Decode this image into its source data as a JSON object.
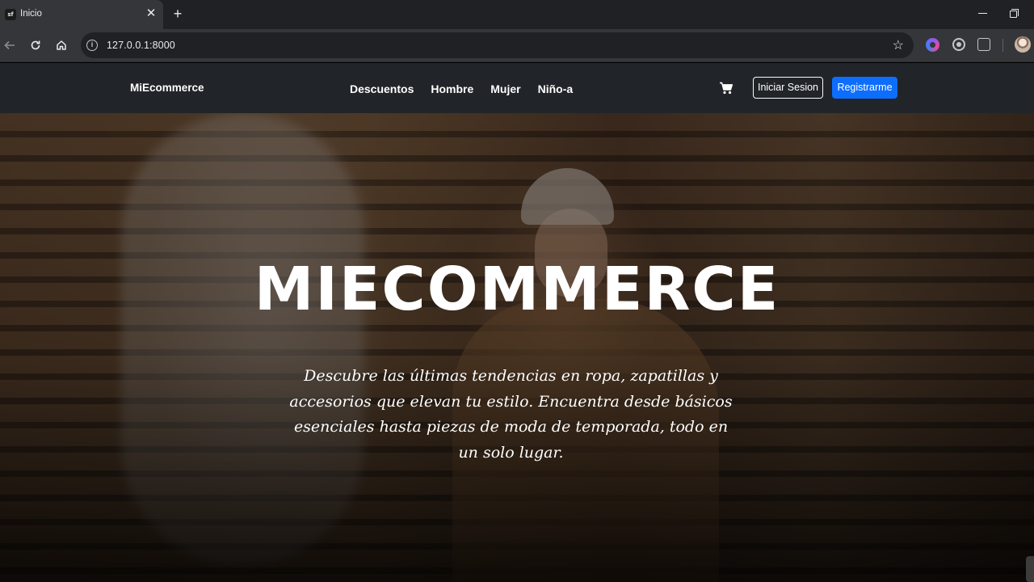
{
  "browser": {
    "tab_title": "Inicio",
    "favicon_text": "sf",
    "tab_close": "✕",
    "new_tab": "+",
    "url": "127.0.0.1:8000",
    "icons": [
      "back-icon",
      "reload-icon",
      "home-icon",
      "site-info-icon",
      "bookmark-star-icon",
      "extension-icon",
      "profile-avatar"
    ]
  },
  "navbar": {
    "brand": "MiEcommerce",
    "links": [
      "Descuentos",
      "Hombre",
      "Mujer",
      "Niño-a"
    ],
    "cart_icon": "cart-icon",
    "login_label": "Iniciar Sesion",
    "register_label": "Registrarme",
    "colors": {
      "background": "#212529",
      "primary": "#0d6efd"
    }
  },
  "hero": {
    "title": "MIECOMMERCE",
    "subtitle": "Descubre las últimas tendencias en ropa, zapatillas y accesorios que elevan tu estilo. Encuentra desde básicos esenciales hasta piezas de moda de temporada, todo en un solo lugar."
  }
}
